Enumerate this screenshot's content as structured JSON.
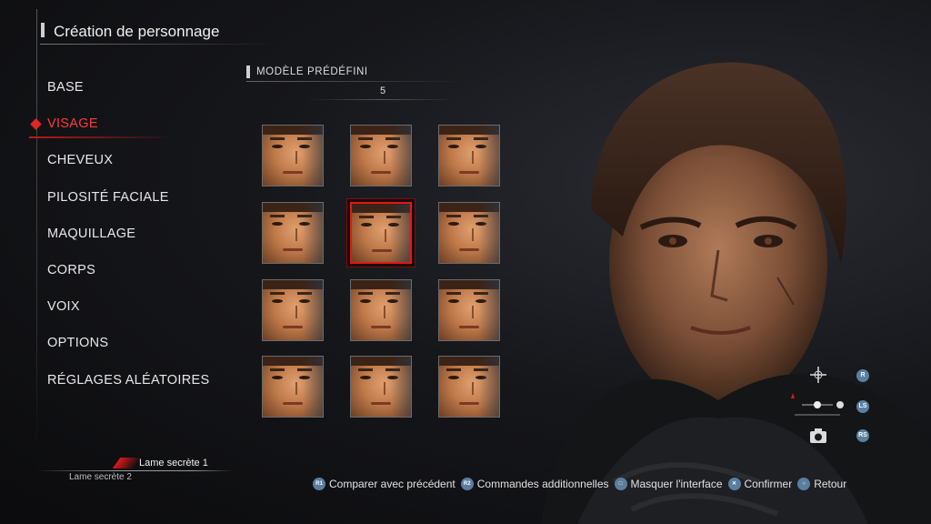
{
  "header": {
    "title": "Création de personnage"
  },
  "menu": {
    "items": [
      {
        "label": "BASE",
        "active": false
      },
      {
        "label": "VISAGE",
        "active": true
      },
      {
        "label": "CHEVEUX",
        "active": false
      },
      {
        "label": "PILOSITÉ FACIALE",
        "active": false
      },
      {
        "label": "MAQUILLAGE",
        "active": false
      },
      {
        "label": "CORPS",
        "active": false
      },
      {
        "label": "VOIX",
        "active": false
      },
      {
        "label": "OPTIONS",
        "active": false
      },
      {
        "label": "RÉGLAGES ALÉATOIRES",
        "active": false
      }
    ]
  },
  "preset": {
    "label": "MODÈLE PRÉDÉFINI",
    "value": "5",
    "selected_index": 5,
    "count": 12
  },
  "blades": {
    "primary": "Lame secrète 1",
    "secondary": "Lame secrète 2"
  },
  "controls": {
    "rotate_button": "R",
    "zoom_button": "LS",
    "photo_button": "RS"
  },
  "footer": {
    "items": [
      {
        "button": "R1",
        "label": "Comparer avec précédent"
      },
      {
        "button": "R2",
        "label": "Commandes additionnelles"
      },
      {
        "button": "□",
        "label": "Masquer l'interface"
      },
      {
        "button": "✕",
        "label": "Confirmer"
      },
      {
        "button": "○",
        "label": "Retour"
      }
    ]
  },
  "colors": {
    "accent": "#e01818",
    "button": "#5b7da0"
  },
  "icons": [
    "move-icon",
    "light-slider-icon",
    "camera-icon"
  ]
}
